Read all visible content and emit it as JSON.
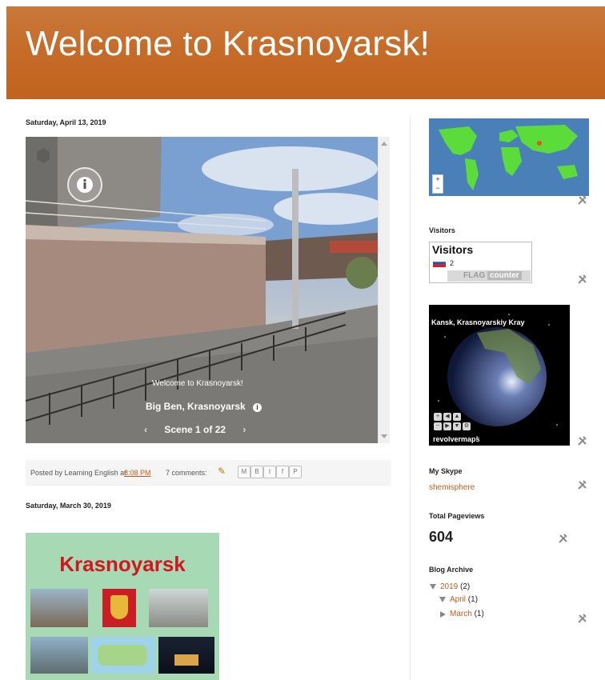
{
  "header": {
    "title": "Welcome to Krasnoyarsk!"
  },
  "posts": [
    {
      "date": "Saturday, April 13, 2019",
      "viewer": {
        "overlay_title": "Welcome to Krasnoyarsk!",
        "place": "Big Ben, Krasnoyarsk",
        "scene": "Scene 1 of 22"
      },
      "footer": {
        "posted_by": "Posted by Learning English at",
        "time": "8:08 PM",
        "comments": "7 comments:",
        "share": [
          "M",
          "B",
          "t",
          "f",
          "P"
        ]
      }
    },
    {
      "date": "Saturday, March 30, 2019",
      "thumb_title": "Krasnoyarsk"
    }
  ],
  "sidebar": {
    "visitors_title": "Visitors",
    "visitors_box_title": "Visitors",
    "visitor_count": "2",
    "flag_counter": {
      "a": "FLAG",
      "b": "counter"
    },
    "globe_location": "Kansk, Krasnoyarskiy Kray",
    "revolvermaps": "revolvermaps",
    "skype_title": "My Skype",
    "skype_name": "shemisphere",
    "pageviews_title": "Total Pageviews",
    "pageviews": "604",
    "archive_title": "Blog Archive",
    "archive": {
      "year": "2019",
      "year_count": "(2)",
      "months": [
        {
          "label": "April",
          "count": "(1)"
        },
        {
          "label": "March",
          "count": "(1)"
        }
      ]
    }
  },
  "map_zoom": {
    "plus": "+",
    "minus": "−"
  }
}
